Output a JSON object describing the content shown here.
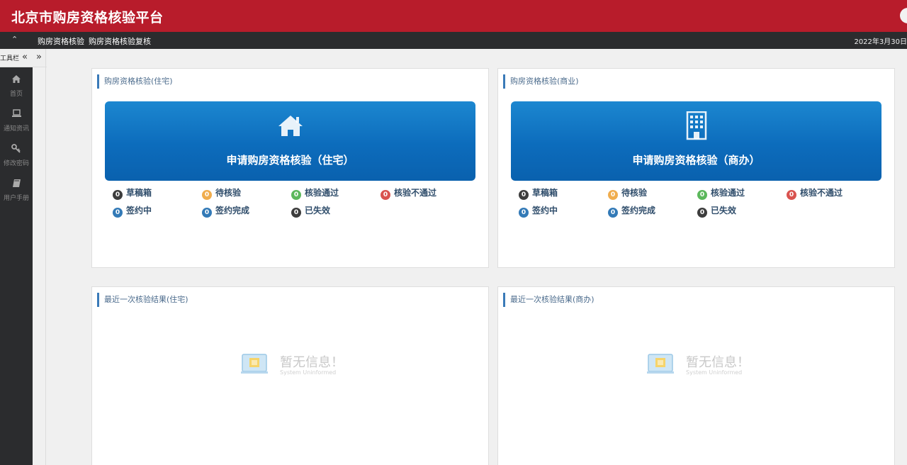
{
  "app": {
    "title": "北京市购房资格核验平台"
  },
  "nav": {
    "items": [
      "购房资格核验",
      "购房资格核验复核"
    ],
    "date": "2022年3月30日"
  },
  "toolbar": {
    "label": "工具栏",
    "collapse": "«",
    "expand": "»"
  },
  "sidebar": {
    "items": [
      {
        "label": "首页",
        "icon": "home-icon"
      },
      {
        "label": "通知资讯",
        "icon": "laptop-icon"
      },
      {
        "label": "修改密码",
        "icon": "key-icon"
      },
      {
        "label": "用户手册",
        "icon": "book-icon"
      }
    ]
  },
  "panels": {
    "residential": {
      "title": "购房资格核验(住宅)",
      "apply_label": "申请购房资格核验（住宅）",
      "statuses": [
        {
          "count": "0",
          "label": "草稿箱",
          "color": "#3d3d3d"
        },
        {
          "count": "0",
          "label": "待核验",
          "color": "#f0ad4e"
        },
        {
          "count": "0",
          "label": "核验通过",
          "color": "#5cb85c"
        },
        {
          "count": "0",
          "label": "核验不通过",
          "color": "#d9534f"
        },
        {
          "count": "0",
          "label": "签约中",
          "color": "#337ab7"
        },
        {
          "count": "0",
          "label": "签约完成",
          "color": "#337ab7"
        },
        {
          "count": "0",
          "label": "已失效",
          "color": "#3d3d3d"
        }
      ]
    },
    "commercial": {
      "title": "购房资格核验(商业)",
      "apply_label": "申请购房资格核验（商办）",
      "statuses": [
        {
          "count": "0",
          "label": "草稿箱",
          "color": "#3d3d3d"
        },
        {
          "count": "0",
          "label": "待核验",
          "color": "#f0ad4e"
        },
        {
          "count": "0",
          "label": "核验通过",
          "color": "#5cb85c"
        },
        {
          "count": "0",
          "label": "核验不通过",
          "color": "#d9534f"
        },
        {
          "count": "0",
          "label": "签约中",
          "color": "#337ab7"
        },
        {
          "count": "0",
          "label": "签约完成",
          "color": "#337ab7"
        },
        {
          "count": "0",
          "label": "已失效",
          "color": "#3d3d3d"
        }
      ]
    },
    "last_residential": {
      "title": "最近一次核验结果(住宅)"
    },
    "last_commercial": {
      "title": "最近一次核验结果(商办)"
    }
  },
  "empty_state": {
    "title": "暂无信息！",
    "subtitle": "System Uninformed"
  },
  "colors": {
    "header": "#b81c2b",
    "navbar": "#2b2c2e",
    "button": "#0c6cbc",
    "accent": "#3a7ab8"
  }
}
